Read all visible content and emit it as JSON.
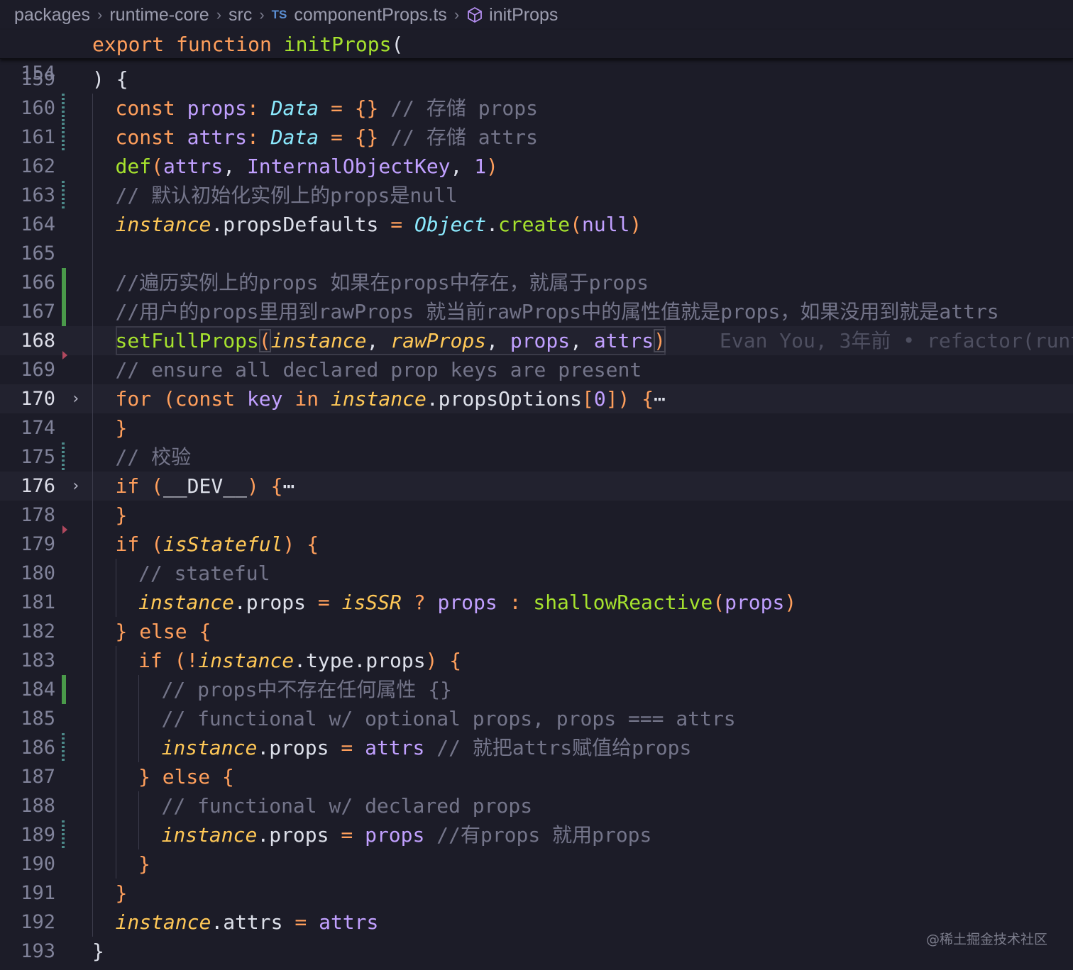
{
  "breadcrumb": {
    "items": [
      "packages",
      "runtime-core",
      "src",
      "componentProps.ts",
      "initProps"
    ],
    "ts_badge": "TS"
  },
  "sticky": {
    "line": "154",
    "code": "export function initProps("
  },
  "blame": "Evan You, 3年前 • refactor(runt",
  "watermark": "@稀土掘金技术社区",
  "code_lines": [
    {
      "n": "159",
      "gutter": "",
      "fold": false,
      "current": false,
      "tokens": [
        [
          "b",
          ") {"
        ]
      ]
    },
    {
      "n": "160",
      "gutter": "mod",
      "tokens": [
        [
          "k",
          "const "
        ],
        [
          "p",
          "props"
        ],
        [
          "k",
          ": "
        ],
        [
          "t",
          "Data"
        ],
        [
          "k",
          " = "
        ],
        [
          "pu",
          "{}"
        ],
        [
          "c",
          " // 存储 props"
        ]
      ]
    },
    {
      "n": "161",
      "gutter": "mod",
      "tokens": [
        [
          "k",
          "const "
        ],
        [
          "p",
          "attrs"
        ],
        [
          "k",
          ": "
        ],
        [
          "t",
          "Data"
        ],
        [
          "k",
          " = "
        ],
        [
          "pu",
          "{}"
        ],
        [
          "c",
          " // 存储 attrs"
        ]
      ]
    },
    {
      "n": "162",
      "gutter": "",
      "tokens": [
        [
          "f",
          "def"
        ],
        [
          "pu",
          "("
        ],
        [
          "p",
          "attrs"
        ],
        [
          "b",
          ", "
        ],
        [
          "p",
          "InternalObjectKey"
        ],
        [
          "b",
          ", "
        ],
        [
          "n",
          "1"
        ],
        [
          "pu",
          ")"
        ]
      ]
    },
    {
      "n": "163",
      "gutter": "mod",
      "tokens": [
        [
          "c",
          "// 默认初始化实例上的props是null"
        ]
      ]
    },
    {
      "n": "164",
      "gutter": "",
      "tokens": [
        [
          "i",
          "instance"
        ],
        [
          "b",
          ".propsDefaults "
        ],
        [
          "k",
          "= "
        ],
        [
          "t",
          "Object"
        ],
        [
          "b",
          "."
        ],
        [
          "f",
          "create"
        ],
        [
          "pu",
          "("
        ],
        [
          "p",
          "null"
        ],
        [
          "pu",
          ")"
        ]
      ]
    },
    {
      "n": "165",
      "gutter": "",
      "tokens": []
    },
    {
      "n": "166",
      "gutter": "add",
      "tokens": [
        [
          "c",
          "//遍历实例上的props 如果在props中存在，就属于props"
        ]
      ]
    },
    {
      "n": "167",
      "gutter": "add",
      "tokens": [
        [
          "c",
          "//用户的props里用到rawProps 就当前rawProps中的属性值就是props，如果没用到就是attrs"
        ]
      ]
    },
    {
      "n": "168",
      "gutter": "",
      "current": true,
      "tokens": [
        [
          "f",
          "setFullProps"
        ],
        [
          "pu",
          "(",
          "hl"
        ],
        [
          "i",
          "instance"
        ],
        [
          "b",
          ", "
        ],
        [
          "i",
          "rawProps"
        ],
        [
          "b",
          ", "
        ],
        [
          "p",
          "props"
        ],
        [
          "b",
          ", "
        ],
        [
          "p",
          "attrs"
        ],
        [
          "pu",
          ")",
          "hl"
        ]
      ]
    },
    {
      "n": "169",
      "gutter": "del",
      "tokens": [
        [
          "c",
          "// ensure all declared prop keys are present"
        ]
      ]
    },
    {
      "n": "170",
      "gutter": "",
      "fold": true,
      "current_soft": true,
      "tokens": [
        [
          "k",
          "for "
        ],
        [
          "pu",
          "("
        ],
        [
          "k",
          "const "
        ],
        [
          "p",
          "key"
        ],
        [
          "k",
          " in "
        ],
        [
          "i",
          "instance"
        ],
        [
          "b",
          ".propsOptions"
        ],
        [
          "pu",
          "["
        ],
        [
          "n",
          "0"
        ],
        [
          "pu",
          "]) {"
        ],
        [
          "b",
          "⋯"
        ]
      ]
    },
    {
      "n": "174",
      "gutter": "",
      "tokens": [
        [
          "pu",
          "}"
        ]
      ]
    },
    {
      "n": "175",
      "gutter": "mod",
      "tokens": [
        [
          "c",
          "// 校验"
        ]
      ]
    },
    {
      "n": "176",
      "gutter": "",
      "fold": true,
      "current_soft": true,
      "tokens": [
        [
          "k",
          "if "
        ],
        [
          "pu",
          "("
        ],
        [
          "b",
          "__DEV__"
        ],
        [
          "pu",
          ") {"
        ],
        [
          "b",
          "⋯"
        ]
      ]
    },
    {
      "n": "178",
      "gutter": "",
      "tokens": [
        [
          "pu",
          "}"
        ]
      ]
    },
    {
      "n": "179",
      "gutter": "del",
      "tokens": [
        [
          "k",
          "if "
        ],
        [
          "pu",
          "("
        ],
        [
          "i",
          "isStateful"
        ],
        [
          "pu",
          ") {"
        ]
      ]
    },
    {
      "n": "180",
      "gutter": "",
      "indent": 1,
      "tokens": [
        [
          "c",
          "// stateful"
        ]
      ]
    },
    {
      "n": "181",
      "gutter": "",
      "indent": 1,
      "tokens": [
        [
          "i",
          "instance"
        ],
        [
          "b",
          ".props "
        ],
        [
          "k",
          "= "
        ],
        [
          "i",
          "isSSR"
        ],
        [
          "k",
          " ? "
        ],
        [
          "p",
          "props"
        ],
        [
          "k",
          " : "
        ],
        [
          "f",
          "shallowReactive"
        ],
        [
          "pu",
          "("
        ],
        [
          "p",
          "props"
        ],
        [
          "pu",
          ")"
        ]
      ]
    },
    {
      "n": "182",
      "gutter": "",
      "tokens": [
        [
          "pu",
          "} "
        ],
        [
          "k",
          "else "
        ],
        [
          "pu",
          "{"
        ]
      ]
    },
    {
      "n": "183",
      "gutter": "",
      "indent": 1,
      "tokens": [
        [
          "k",
          "if "
        ],
        [
          "pu",
          "("
        ],
        [
          "k",
          "!"
        ],
        [
          "i",
          "instance"
        ],
        [
          "b",
          ".type.props"
        ],
        [
          "pu",
          ") {"
        ]
      ]
    },
    {
      "n": "184",
      "gutter": "add",
      "indent": 2,
      "tokens": [
        [
          "c",
          "// props中不存在任何属性 {}"
        ]
      ]
    },
    {
      "n": "185",
      "gutter": "",
      "indent": 2,
      "tokens": [
        [
          "c",
          "// functional w/ optional props, props === attrs"
        ]
      ]
    },
    {
      "n": "186",
      "gutter": "mod",
      "indent": 2,
      "tokens": [
        [
          "i",
          "instance"
        ],
        [
          "b",
          ".props "
        ],
        [
          "k",
          "= "
        ],
        [
          "p",
          "attrs"
        ],
        [
          "c",
          " // 就把attrs赋值给props"
        ]
      ]
    },
    {
      "n": "187",
      "gutter": "",
      "indent": 1,
      "tokens": [
        [
          "pu",
          "} "
        ],
        [
          "k",
          "else "
        ],
        [
          "pu",
          "{"
        ]
      ]
    },
    {
      "n": "188",
      "gutter": "",
      "indent": 2,
      "tokens": [
        [
          "c",
          "// functional w/ declared props"
        ]
      ]
    },
    {
      "n": "189",
      "gutter": "mod",
      "indent": 2,
      "tokens": [
        [
          "i",
          "instance"
        ],
        [
          "b",
          ".props "
        ],
        [
          "k",
          "= "
        ],
        [
          "p",
          "props"
        ],
        [
          "c",
          " //有props 就用props"
        ]
      ]
    },
    {
      "n": "190",
      "gutter": "",
      "indent": 1,
      "tokens": [
        [
          "pu",
          "}"
        ]
      ]
    },
    {
      "n": "191",
      "gutter": "",
      "tokens": [
        [
          "pu",
          "}"
        ]
      ]
    },
    {
      "n": "192",
      "gutter": "",
      "tokens": [
        [
          "i",
          "instance"
        ],
        [
          "b",
          ".attrs "
        ],
        [
          "k",
          "= "
        ],
        [
          "p",
          "attrs"
        ]
      ]
    },
    {
      "n": "193",
      "gutter": "",
      "outer": true,
      "tokens": [
        [
          "b",
          "}"
        ]
      ]
    }
  ]
}
